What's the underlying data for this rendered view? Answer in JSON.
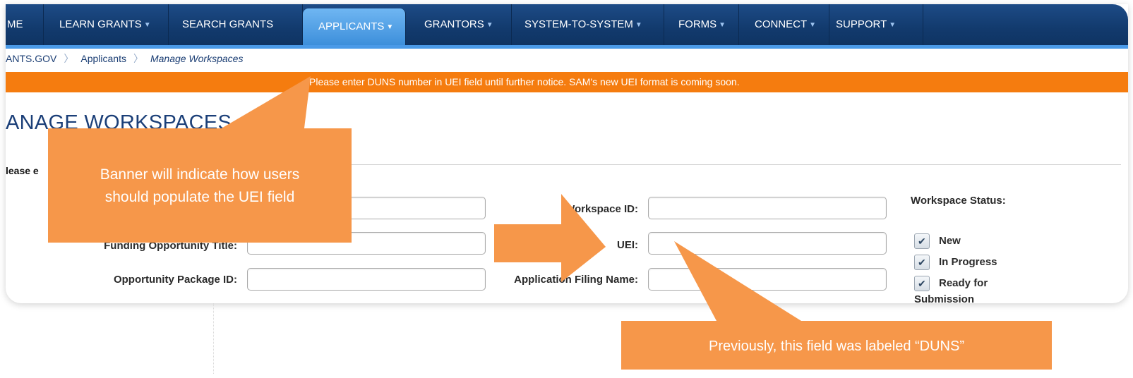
{
  "nav": {
    "items": [
      {
        "label": "ME",
        "caret": false
      },
      {
        "label": "LEARN GRANTS",
        "caret": true
      },
      {
        "label": "SEARCH GRANTS",
        "caret": false
      },
      {
        "label": "APPLICANTS",
        "caret": true,
        "active": true
      },
      {
        "label": "GRANTORS",
        "caret": true
      },
      {
        "label": "SYSTEM-TO-SYSTEM",
        "caret": true
      },
      {
        "label": "FORMS",
        "caret": true
      },
      {
        "label": "CONNECT",
        "caret": true
      },
      {
        "label": "SUPPORT",
        "caret": true
      }
    ],
    "caret_glyph": "▼"
  },
  "breadcrumb": {
    "items": [
      "ANTS.GOV",
      "Applicants",
      "Manage Workspaces"
    ],
    "separator": "〉"
  },
  "banner": {
    "text": "Please enter DUNS number in UEI field until further notice. SAM's new UEI format is coming soon."
  },
  "page": {
    "title": "ANAGE WORKSPACES",
    "instruction": "lease e"
  },
  "form": {
    "funding_opportunity_title_label": "Funding Opportunity Title:",
    "opportunity_package_id_label": "Opportunity Package ID:",
    "workspace_id_label": "Workspace ID:",
    "uei_label": "UEI:",
    "application_filing_name_label": "Application Filing Name:",
    "workspace_status_label": "Workspace Status:",
    "status_options": [
      {
        "label": "New",
        "checked": true
      },
      {
        "label": "In Progress",
        "checked": true
      },
      {
        "label": "Ready for",
        "checked": true
      }
    ],
    "status_overflow_text": "Submission"
  },
  "callouts": {
    "banner_note": [
      "Banner will indicate how users",
      "should populate the UEI field"
    ],
    "uei_note": "Previously, this field was labeled “DUNS”"
  },
  "colors": {
    "nav_bg": "#123a6d",
    "nav_active": "#4a9ae8",
    "banner_bg": "#f57c0f",
    "callout_bg": "#f6974a",
    "title": "#1b3f78"
  }
}
